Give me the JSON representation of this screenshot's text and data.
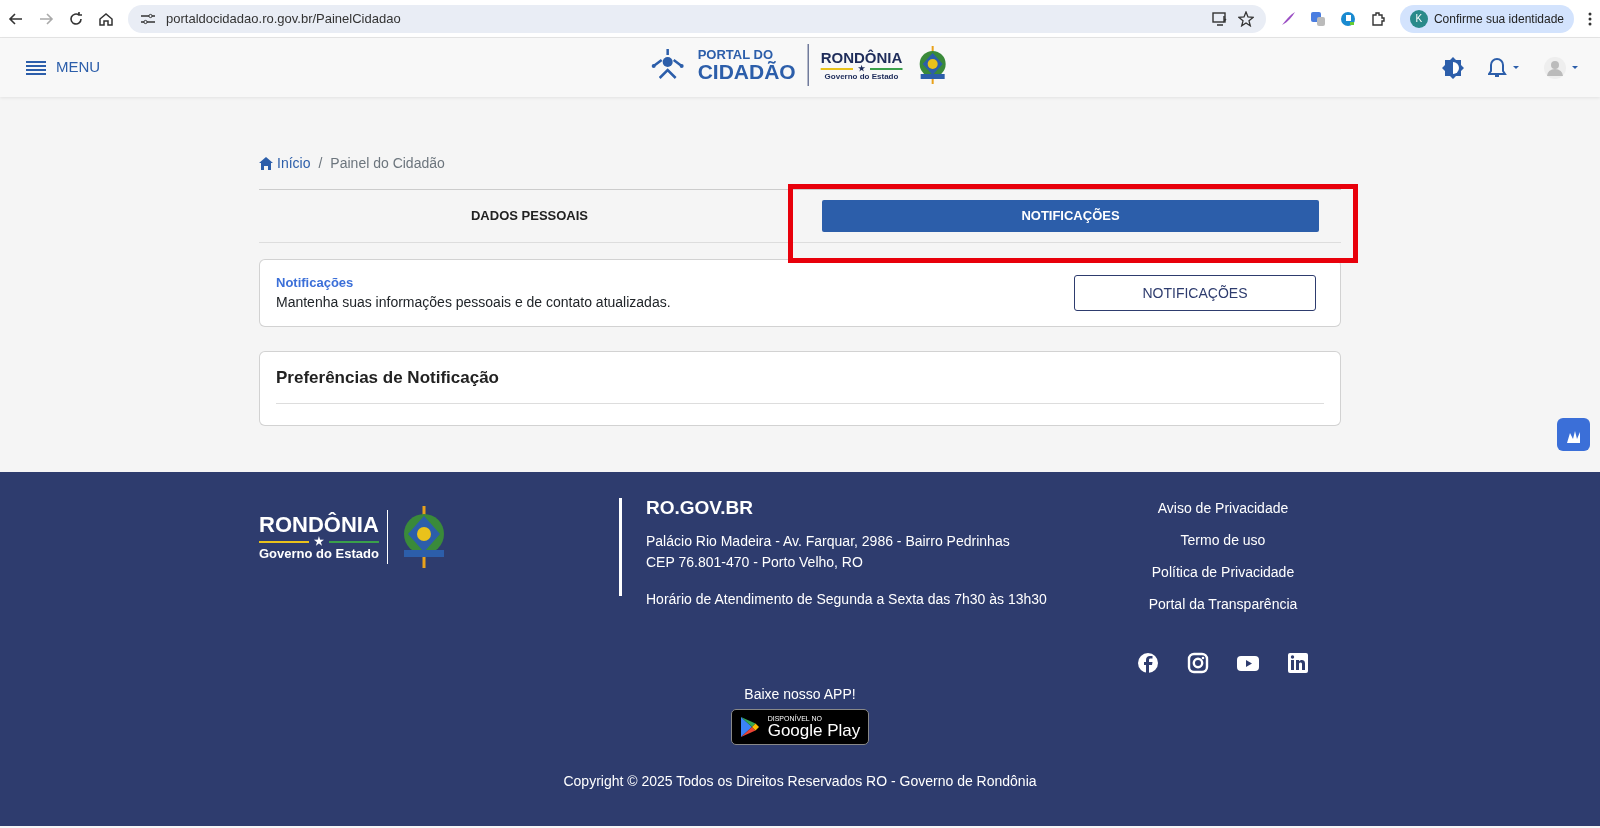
{
  "browser": {
    "url": "portaldocidadao.ro.gov.br/PainelCidadao",
    "profile_initial": "K",
    "profile_label": "Confirme sua identidade"
  },
  "header": {
    "menu_label": "MENU",
    "portal_logo": [
      "PORTAL DO",
      "CIDADÃO"
    ],
    "state_logo": [
      "RONDÔNIA",
      "★",
      "Governo do Estado"
    ]
  },
  "breadcrumb_separator": "/",
  "breadcrumb": [
    {
      "label": "Início"
    },
    {
      "label": "Painel do Cidadão"
    }
  ],
  "tabs": [
    {
      "label": "DADOS PESSOAIS",
      "selected": false
    },
    {
      "label": "NOTIFICAÇÕES",
      "selected": true
    }
  ],
  "info_card": {
    "title": "Notificações",
    "text": "Mantenha suas informações pessoais e de contato atualizadas.",
    "button": "NOTIFICAÇÕES"
  },
  "preferences_card": {
    "title": "Preferências de Notificação"
  },
  "footer": {
    "logo": [
      "RONDÔNIA",
      "★",
      "Governo do Estado"
    ],
    "site": "RO.GOV.BR",
    "address": [
      "Palácio Rio Madeira - Av. Farquar, 2986 - Bairro Pedrinhas",
      "CEP 76.801-470 - Porto Velho, RO"
    ],
    "hours": "Horário de Atendimento de Segunda a Sexta das 7h30 às 13h30",
    "links": [
      "Aviso de Privacidade",
      "Termo de uso",
      "Política de Privacidade",
      "Portal da Transparência"
    ],
    "socials": [
      {
        "kind": "facebook"
      },
      {
        "kind": "instagram"
      },
      {
        "kind": "youtube"
      },
      {
        "kind": "linkedin"
      }
    ],
    "app_label": "Baixe nosso APP!",
    "store_badge": [
      "DISPONÍVEL NO",
      "Google Play"
    ],
    "copyright": "Copyright © 2025 Todos os Direitos Reservados RO - Governo de Rondônia"
  }
}
